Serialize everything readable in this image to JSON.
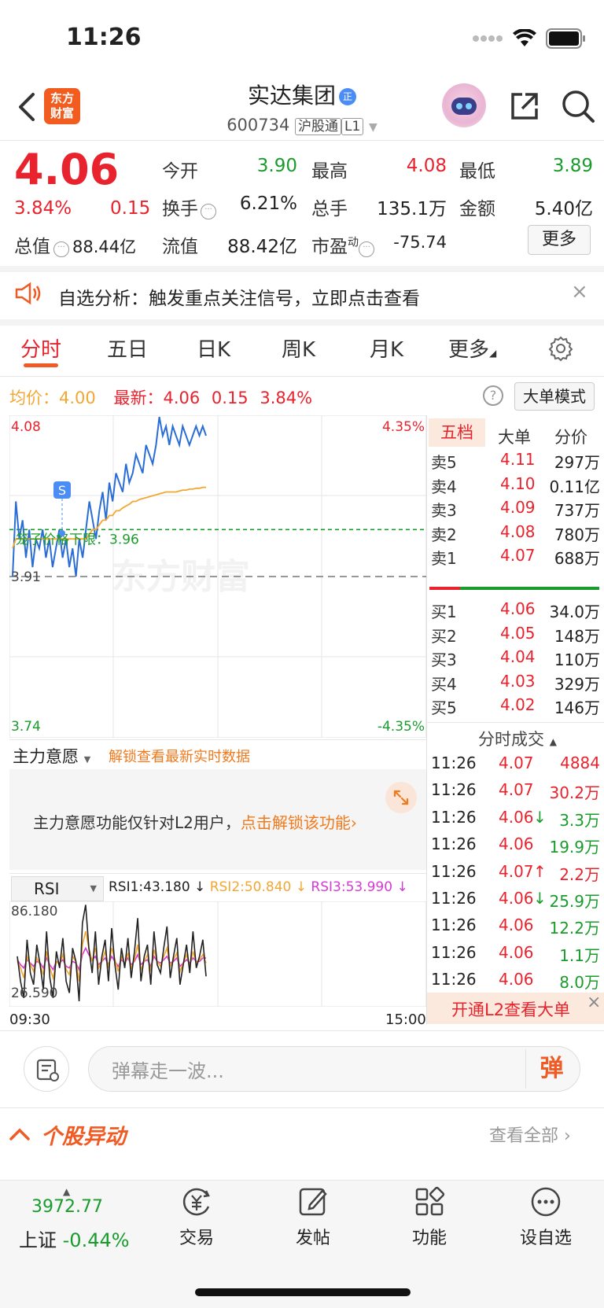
{
  "status_bar": {
    "time": "11:26"
  },
  "header": {
    "logo_line1": "东方",
    "logo_line2": "财富",
    "stock_name": "实达集团",
    "name_badge": "正",
    "code": "600734",
    "tag_hsgt": "沪股通",
    "tag_level": "L1"
  },
  "quote": {
    "price": "4.06",
    "change_pct": "3.84%",
    "change": "0.15",
    "total_value_label": "总值",
    "total_value": "88.44亿",
    "open_label": "今开",
    "open": "3.90",
    "high_label": "最高",
    "high": "4.08",
    "low_label": "最低",
    "low": "3.89",
    "turnover_label": "换手",
    "turnover": "6.21%",
    "volume_label": "总手",
    "volume": "135.1万",
    "amount_label": "金额",
    "amount": "5.40亿",
    "float_label": "流值",
    "float_value": "88.42亿",
    "pe_label": "市盈",
    "pe_sup": "动",
    "pe": "-75.74",
    "more_button": "更多"
  },
  "alert": {
    "text": "自选分析：触发重点关注信号，立即点击查看",
    "close": "×"
  },
  "tabs": [
    "分时",
    "五日",
    "日K",
    "周K",
    "月K",
    "更多"
  ],
  "info_line": {
    "avg_label": "均价：",
    "avg": "4.00",
    "latest_label": "最新：",
    "latest": "4.06",
    "change": "0.15",
    "change_pct": "3.84%",
    "help": "?",
    "big_order_button": "大单模式"
  },
  "chart_data": {
    "type": "line",
    "title": "",
    "y_max_label": "4.08",
    "y_min_label": "3.74",
    "pct_max_label": "4.35%",
    "pct_min_label": "-4.35%",
    "prev_close_label": "3.91",
    "lower_limit_label": "笼子价格下限：3.96",
    "marker": "S",
    "ylim": [
      3.74,
      4.08
    ],
    "prev_close": 3.91,
    "lower_limit": 3.96,
    "series": [
      {
        "name": "最新",
        "color": "#2a6dd6",
        "values": [
          3.91,
          3.99,
          3.95,
          3.97,
          3.93,
          3.96,
          3.92,
          3.95,
          3.94,
          3.96,
          3.93,
          3.95,
          3.92,
          3.94,
          3.96,
          3.93,
          3.95,
          3.92,
          3.94,
          3.91,
          3.95,
          3.93,
          3.96,
          3.99,
          3.97,
          3.95,
          3.98,
          4.0,
          3.97,
          4.01,
          3.99,
          4.02,
          4.01,
          4.0,
          4.03,
          4.01,
          4.02,
          4.04,
          4.03,
          4.02,
          4.05,
          4.04,
          4.03,
          4.05,
          4.08,
          4.06,
          4.07,
          4.05,
          4.07,
          4.06,
          4.05,
          4.07,
          4.06,
          4.05,
          4.06,
          4.07,
          4.06,
          4.07,
          4.06
        ]
      },
      {
        "name": "均价",
        "color": "#f3a733",
        "values": [
          3.94,
          3.95,
          3.95,
          3.95,
          3.95,
          3.95,
          3.95,
          3.95,
          3.95,
          3.95,
          3.95,
          3.95,
          3.95,
          3.95,
          3.95,
          3.95,
          3.95,
          3.95,
          3.95,
          3.95,
          3.95,
          3.95,
          3.95,
          3.955,
          3.96,
          3.96,
          3.965,
          3.97,
          3.97,
          3.975,
          3.975,
          3.98,
          3.98,
          3.983,
          3.985,
          3.987,
          3.99,
          3.99,
          3.992,
          3.993,
          3.994,
          3.995,
          3.996,
          3.997,
          3.998,
          3.999,
          4.0,
          4.0,
          4.0,
          4.0,
          4.001,
          4.002,
          4.002,
          4.003,
          4.003,
          4.004,
          4.004,
          4.005,
          4.005
        ]
      }
    ]
  },
  "order_book": {
    "tabs": [
      "五档",
      "大单",
      "分价"
    ],
    "asks": [
      {
        "label": "卖5",
        "price": "4.11",
        "volume": "297万"
      },
      {
        "label": "卖4",
        "price": "4.10",
        "volume": "0.11亿"
      },
      {
        "label": "卖3",
        "price": "4.09",
        "volume": "737万"
      },
      {
        "label": "卖2",
        "price": "4.08",
        "volume": "780万"
      },
      {
        "label": "卖1",
        "price": "4.07",
        "volume": "688万"
      }
    ],
    "bids": [
      {
        "label": "买1",
        "price": "4.06",
        "volume": "34.0万"
      },
      {
        "label": "买2",
        "price": "4.05",
        "volume": "148万"
      },
      {
        "label": "买3",
        "price": "4.04",
        "volume": "110万"
      },
      {
        "label": "买4",
        "price": "4.03",
        "volume": "329万"
      },
      {
        "label": "买5",
        "price": "4.02",
        "volume": "146万"
      }
    ],
    "trades_title": "分时成交",
    "trades": [
      {
        "time": "11:26",
        "price": "4.07",
        "arrow": "",
        "volume": "4884",
        "color": "#e8232d"
      },
      {
        "time": "11:26",
        "price": "4.07",
        "arrow": "",
        "volume": "30.2万",
        "color": "#e8232d"
      },
      {
        "time": "11:26",
        "price": "4.06",
        "arrow": "↓",
        "volume": "3.3万",
        "color": "#1a9c2d"
      },
      {
        "time": "11:26",
        "price": "4.06",
        "arrow": "",
        "volume": "19.9万",
        "color": "#1a9c2d"
      },
      {
        "time": "11:26",
        "price": "4.07",
        "arrow": "↑",
        "volume": "2.2万",
        "color": "#e8232d"
      },
      {
        "time": "11:26",
        "price": "4.06",
        "arrow": "↓",
        "volume": "25.9万",
        "color": "#1a9c2d"
      },
      {
        "time": "11:26",
        "price": "4.06",
        "arrow": "",
        "volume": "12.2万",
        "color": "#1a9c2d"
      },
      {
        "time": "11:26",
        "price": "4.06",
        "arrow": "",
        "volume": "1.1万",
        "color": "#1a9c2d"
      },
      {
        "time": "11:26",
        "price": "4.06",
        "arrow": "",
        "volume": "8.0万",
        "color": "#1a9c2d"
      }
    ],
    "l2_banner": "开通L2查看大单"
  },
  "zhuli": {
    "label": "主力意愿",
    "unlock": "解锁查看最新实时数据",
    "text": "主力意愿功能仅针对L2用户，",
    "link": "点击解锁该功能"
  },
  "rsi": {
    "selector": "RSI",
    "rsi1": "RSI1:43.180 ↓",
    "rsi2": "RSI2:50.840 ↓",
    "rsi3": "RSI3:53.990 ↓",
    "max_label": "86.180",
    "min_label": "26.590",
    "ylim": [
      26.59,
      86.18
    ],
    "rsi1_values": [
      55,
      40,
      30,
      65,
      45,
      38,
      62,
      50,
      35,
      70,
      42,
      30,
      58,
      48,
      66,
      40,
      33,
      60,
      52,
      28,
      75,
      86,
      60,
      45,
      70,
      38,
      55,
      65,
      40,
      72,
      50,
      35,
      60,
      48,
      66,
      42,
      58,
      78,
      40,
      55,
      62,
      38,
      70,
      50,
      45,
      60,
      73,
      42,
      55,
      66,
      38,
      50,
      62,
      45,
      70,
      48,
      55,
      65,
      43
    ],
    "rsi2_values": [
      52,
      48,
      42,
      55,
      50,
      46,
      54,
      50,
      44,
      58,
      48,
      42,
      52,
      50,
      56,
      47,
      44,
      55,
      52,
      40,
      62,
      70,
      60,
      52,
      60,
      48,
      52,
      58,
      48,
      60,
      53,
      46,
      55,
      50,
      57,
      48,
      53,
      62,
      47,
      52,
      56,
      46,
      59,
      52,
      49,
      55,
      60,
      49,
      53,
      57,
      46,
      51,
      56,
      49,
      58,
      51,
      53,
      56,
      51
    ],
    "rsi3_values": [
      53,
      50,
      48,
      53,
      51,
      49,
      52,
      51,
      48,
      54,
      50,
      47,
      52,
      51,
      53,
      49,
      48,
      52,
      51,
      47,
      56,
      60,
      56,
      53,
      55,
      50,
      52,
      54,
      50,
      55,
      52,
      49,
      53,
      51,
      54,
      50,
      52,
      56,
      50,
      52,
      53,
      49,
      55,
      52,
      51,
      53,
      55,
      51,
      52,
      54,
      49,
      51,
      53,
      51,
      54,
      52,
      52,
      54,
      54
    ],
    "time_start": "09:30",
    "time_end": "15:00"
  },
  "comment": {
    "placeholder": "弹幕走一波...",
    "send": "弹"
  },
  "section": {
    "title": "个股异动",
    "more": "查看全部"
  },
  "bottom_nav": {
    "index_value": "3972.77",
    "index_name": "上证",
    "index_change": "-0.44%",
    "items": [
      "交易",
      "发帖",
      "功能",
      "设自选"
    ]
  }
}
